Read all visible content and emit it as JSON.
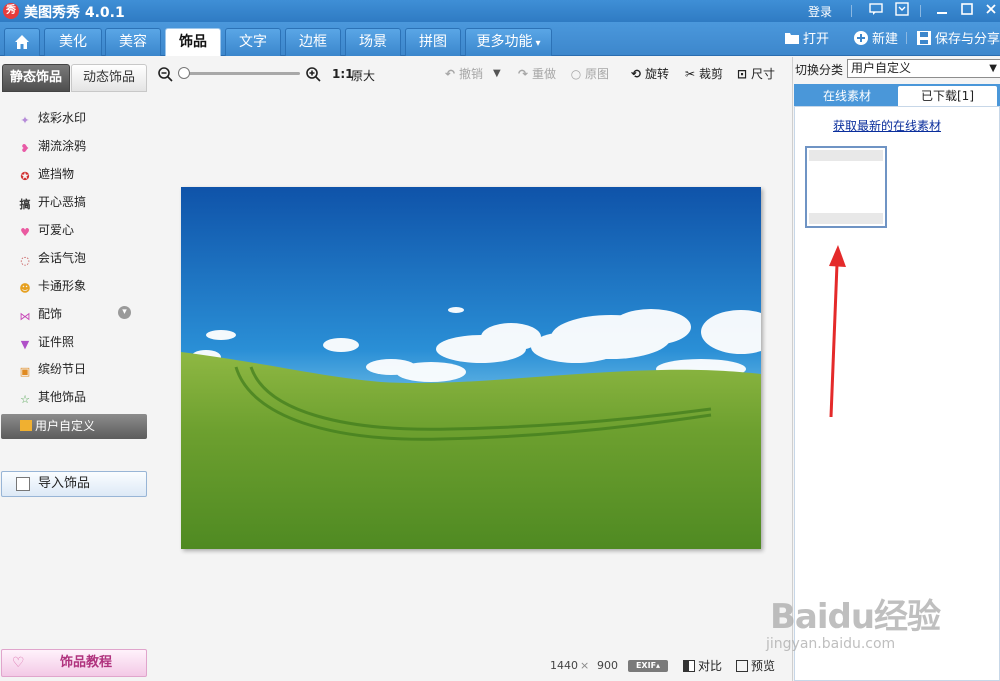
{
  "app": {
    "logo_char": "秀",
    "title": "美图秀秀 4.0.1",
    "login": "登录"
  },
  "tabs": [
    {
      "label": "美化"
    },
    {
      "label": "美容"
    },
    {
      "label": "饰品",
      "active": true
    },
    {
      "label": "文字"
    },
    {
      "label": "边框"
    },
    {
      "label": "场景"
    },
    {
      "label": "拼图"
    },
    {
      "label": "更多功能"
    }
  ],
  "top_actions": {
    "open": "打开",
    "new": "新建",
    "save_share": "保存与分享"
  },
  "left_panel": {
    "subtabs": [
      "静态饰品",
      "动态饰品"
    ],
    "categories": [
      {
        "label": "炫彩水印",
        "icon": "sparkle-icon"
      },
      {
        "label": "潮流涂鸦",
        "icon": "lips-icon"
      },
      {
        "label": "遮挡物",
        "icon": "mask-icon"
      },
      {
        "label": "开心恶搞",
        "icon": "prank-icon"
      },
      {
        "label": "可爱心",
        "icon": "heart-icon"
      },
      {
        "label": "会话气泡",
        "icon": "speech-bubble-icon"
      },
      {
        "label": "卡通形象",
        "icon": "cartoon-face-icon"
      },
      {
        "label": "配饰",
        "icon": "bow-icon"
      },
      {
        "label": "证件照",
        "icon": "shirt-icon"
      },
      {
        "label": "缤纷节日",
        "icon": "gift-icon"
      },
      {
        "label": "其他饰品",
        "icon": "star-outline-icon"
      }
    ],
    "selected_category": "用户自定义",
    "import_button": "导入饰品",
    "tutorial_button": "饰品教程"
  },
  "toolbar": {
    "zoom_ratio": "1:1",
    "original_size": "原大",
    "undo": "撤销",
    "redo": "重做",
    "original": "原图",
    "rotate": "旋转",
    "crop": "裁剪",
    "resize": "尺寸"
  },
  "status": {
    "width": "1440",
    "times": "×",
    "height": "900",
    "exif": "EXIF",
    "compare": "对比",
    "preview": "预览"
  },
  "right_panel": {
    "switch_label": "切换分类",
    "select_value": "用户自定义",
    "tabs": [
      "在线素材",
      "已下载[1]"
    ],
    "link": "获取最新的在线素材"
  },
  "watermark": {
    "main": "Baidu经验",
    "sub": "jingyan.baidu.com"
  },
  "colors": {
    "titlebar": "#2f7bc3",
    "accent": "#4a97d9",
    "arrow_red": "#e42a2a"
  }
}
